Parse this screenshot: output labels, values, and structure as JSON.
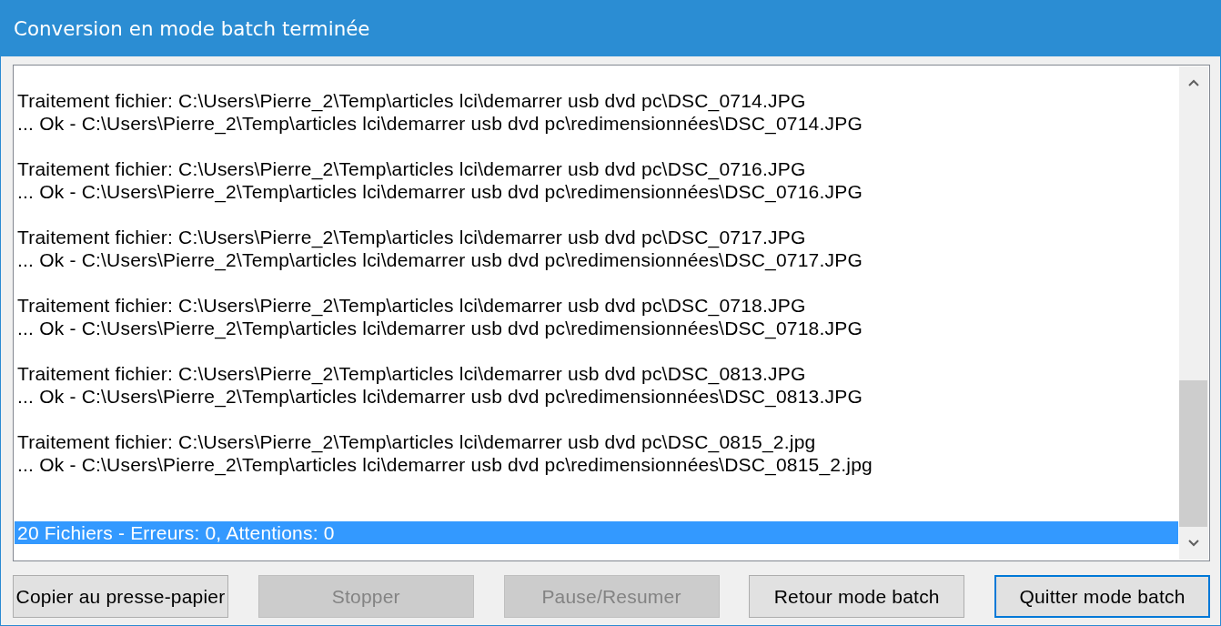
{
  "window": {
    "title": "Conversion en mode batch terminée"
  },
  "log": {
    "entries": [
      {
        "processing": "Traitement fichier: C:\\Users\\Pierre_2\\Temp\\articles lci\\demarrer usb dvd pc\\DSC_0714.JPG",
        "result": "... Ok - C:\\Users\\Pierre_2\\Temp\\articles lci\\demarrer usb dvd pc\\redimensionnées\\DSC_0714.JPG"
      },
      {
        "processing": "Traitement fichier: C:\\Users\\Pierre_2\\Temp\\articles lci\\demarrer usb dvd pc\\DSC_0716.JPG",
        "result": "... Ok - C:\\Users\\Pierre_2\\Temp\\articles lci\\demarrer usb dvd pc\\redimensionnées\\DSC_0716.JPG"
      },
      {
        "processing": "Traitement fichier: C:\\Users\\Pierre_2\\Temp\\articles lci\\demarrer usb dvd pc\\DSC_0717.JPG",
        "result": "... Ok - C:\\Users\\Pierre_2\\Temp\\articles lci\\demarrer usb dvd pc\\redimensionnées\\DSC_0717.JPG"
      },
      {
        "processing": "Traitement fichier: C:\\Users\\Pierre_2\\Temp\\articles lci\\demarrer usb dvd pc\\DSC_0718.JPG",
        "result": "... Ok - C:\\Users\\Pierre_2\\Temp\\articles lci\\demarrer usb dvd pc\\redimensionnées\\DSC_0718.JPG"
      },
      {
        "processing": "Traitement fichier: C:\\Users\\Pierre_2\\Temp\\articles lci\\demarrer usb dvd pc\\DSC_0813.JPG",
        "result": "... Ok - C:\\Users\\Pierre_2\\Temp\\articles lci\\demarrer usb dvd pc\\redimensionnées\\DSC_0813.JPG"
      },
      {
        "processing": "Traitement fichier: C:\\Users\\Pierre_2\\Temp\\articles lci\\demarrer usb dvd pc\\DSC_0815_2.jpg",
        "result": "... Ok - C:\\Users\\Pierre_2\\Temp\\articles lci\\demarrer usb dvd pc\\redimensionnées\\DSC_0815_2.jpg"
      }
    ],
    "summary": {
      "text": "20 Fichiers - Erreurs: 0, Attentions: 0",
      "selected": true
    }
  },
  "buttons": [
    {
      "label": "Copier au presse-papier",
      "disabled": false,
      "focused": false
    },
    {
      "label": "Stopper",
      "disabled": true,
      "focused": false
    },
    {
      "label": "Pause/Resumer",
      "disabled": true,
      "focused": false
    },
    {
      "label": "Retour mode batch",
      "disabled": false,
      "focused": false
    },
    {
      "label": "Quitter mode batch",
      "disabled": false,
      "focused": true
    }
  ]
}
